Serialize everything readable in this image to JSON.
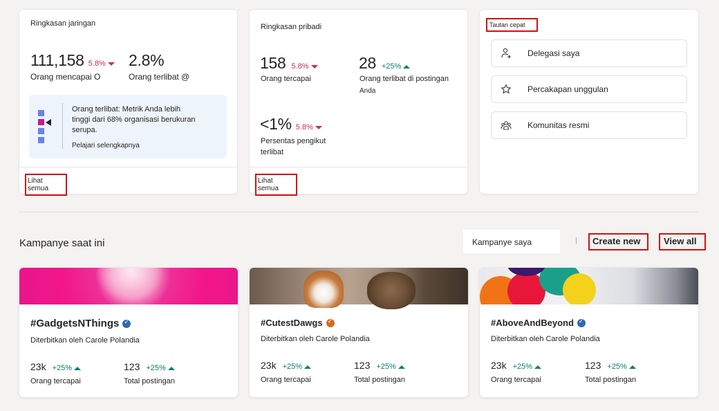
{
  "network_summary": {
    "title": "Ringkasan jaringan",
    "metric1": {
      "value": "111,158",
      "change": "5.8%",
      "label": "Orang mencapai O"
    },
    "metric2": {
      "value": "2.8%",
      "label": "Orang terlibat @"
    },
    "info": {
      "text": "Orang terlibat: Metrik Anda lebih tinggi dari 68% organisasi berukuran serupa.",
      "link": "Pelajari selengkapnya"
    },
    "see_all": "Lihat semua"
  },
  "personal_summary": {
    "title": "Ringkasan pribadi",
    "metric1": {
      "value": "158",
      "change": "5.8%",
      "label": "Orang tercapai"
    },
    "metric2": {
      "value": "28",
      "change": "+25%",
      "label": "Orang terlibat di postingan",
      "sublabel": "Anda"
    },
    "metric3": {
      "value": "<1%",
      "change": "5.8%",
      "label": "Persentas pengikut terlibat"
    },
    "see_all": "Lihat semua"
  },
  "quick_links": {
    "title": "Tautan cepat",
    "items": [
      {
        "label": "Delegasi saya",
        "icon": "delegate-icon"
      },
      {
        "label": "Percakapan unggulan",
        "icon": "star-icon"
      },
      {
        "label": "Komunitas resmi",
        "icon": "community-icon"
      }
    ]
  },
  "campaigns": {
    "title": "Kampanye saat ini",
    "filter_label": "Kampanye saya",
    "create_new": "Create new",
    "view_all": "View all",
    "cards": [
      {
        "title": "#GadgetsNThings",
        "verified_color": "#2b6cb0",
        "author": "Diterbitkan oleh Carole Polandia",
        "reach": "23k",
        "reach_change": "+25%",
        "reach_label": "Orang tercapai",
        "posts": "123",
        "posts_change": "+25%",
        "posts_label": "Total postingan"
      },
      {
        "title": "#CutestDawgs",
        "verified_color": "#d86b1f",
        "author": "Diterbitkan oleh Carole Polandia",
        "reach": "23k",
        "reach_change": "+25%",
        "reach_label": "Orang tercapai",
        "posts": "123",
        "posts_change": "+25%",
        "posts_label": "Total postingan"
      },
      {
        "title": "#AboveAndBeyond",
        "verified_color": "#2b6cb0",
        "author": "Diterbitkan oleh Carole Polandia",
        "reach": "23k",
        "reach_change": "+25%",
        "reach_label": "Orang tercapai",
        "posts": "123",
        "posts_change": "+25%",
        "posts_label": "Total postingan"
      }
    ]
  }
}
